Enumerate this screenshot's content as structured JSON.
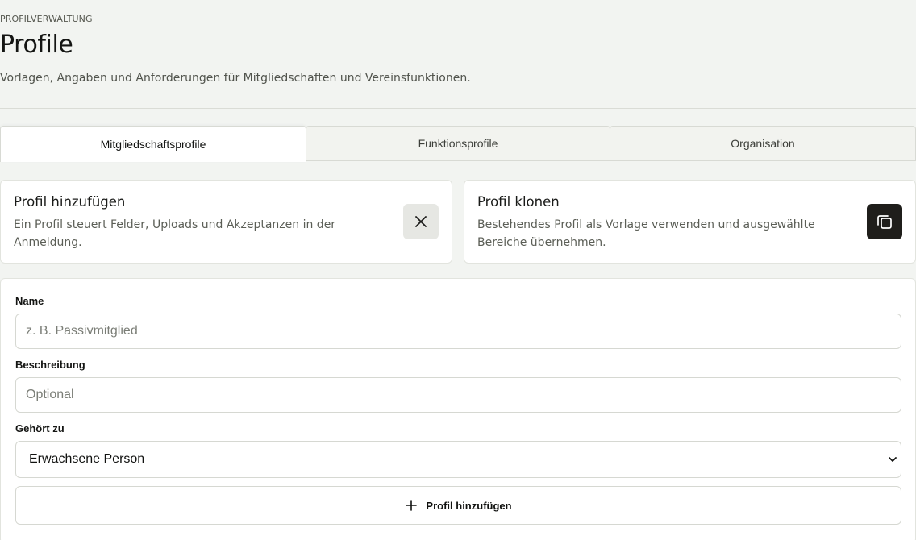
{
  "header": {
    "eyebrow": "PROFILVERWALTUNG",
    "title": "Profile",
    "subtitle": "Vorlagen, Angaben und Anforderungen für Mitgliedschaften und Vereinsfunktionen."
  },
  "tabs": [
    {
      "label": "Mitgliedschaftsprofile",
      "active": true
    },
    {
      "label": "Funktionsprofile",
      "active": false
    },
    {
      "label": "Organisation",
      "active": false
    }
  ],
  "cards": {
    "add": {
      "title": "Profil hinzufügen",
      "text": "Ein Profil steuert Felder, Uploads und Akzeptanzen in der Anmeldung.",
      "icon": "close-icon"
    },
    "clone": {
      "title": "Profil klonen",
      "text": "Bestehendes Profil als Vorlage verwenden und ausgewählte Bereiche übernehmen.",
      "icon": "copy-icon"
    }
  },
  "form": {
    "name_label": "Name",
    "name_placeholder": "z. B. Passivmitglied",
    "description_label": "Beschreibung",
    "description_placeholder": "Optional",
    "belongs_label": "Gehört zu",
    "belongs_value": "Erwachsene Person",
    "submit_label": "Profil hinzufügen"
  },
  "colors": {
    "background": "#f2f4f1",
    "surface": "#ffffff",
    "dark_button": "#1f1e1b",
    "border": "#d6d8d2"
  }
}
